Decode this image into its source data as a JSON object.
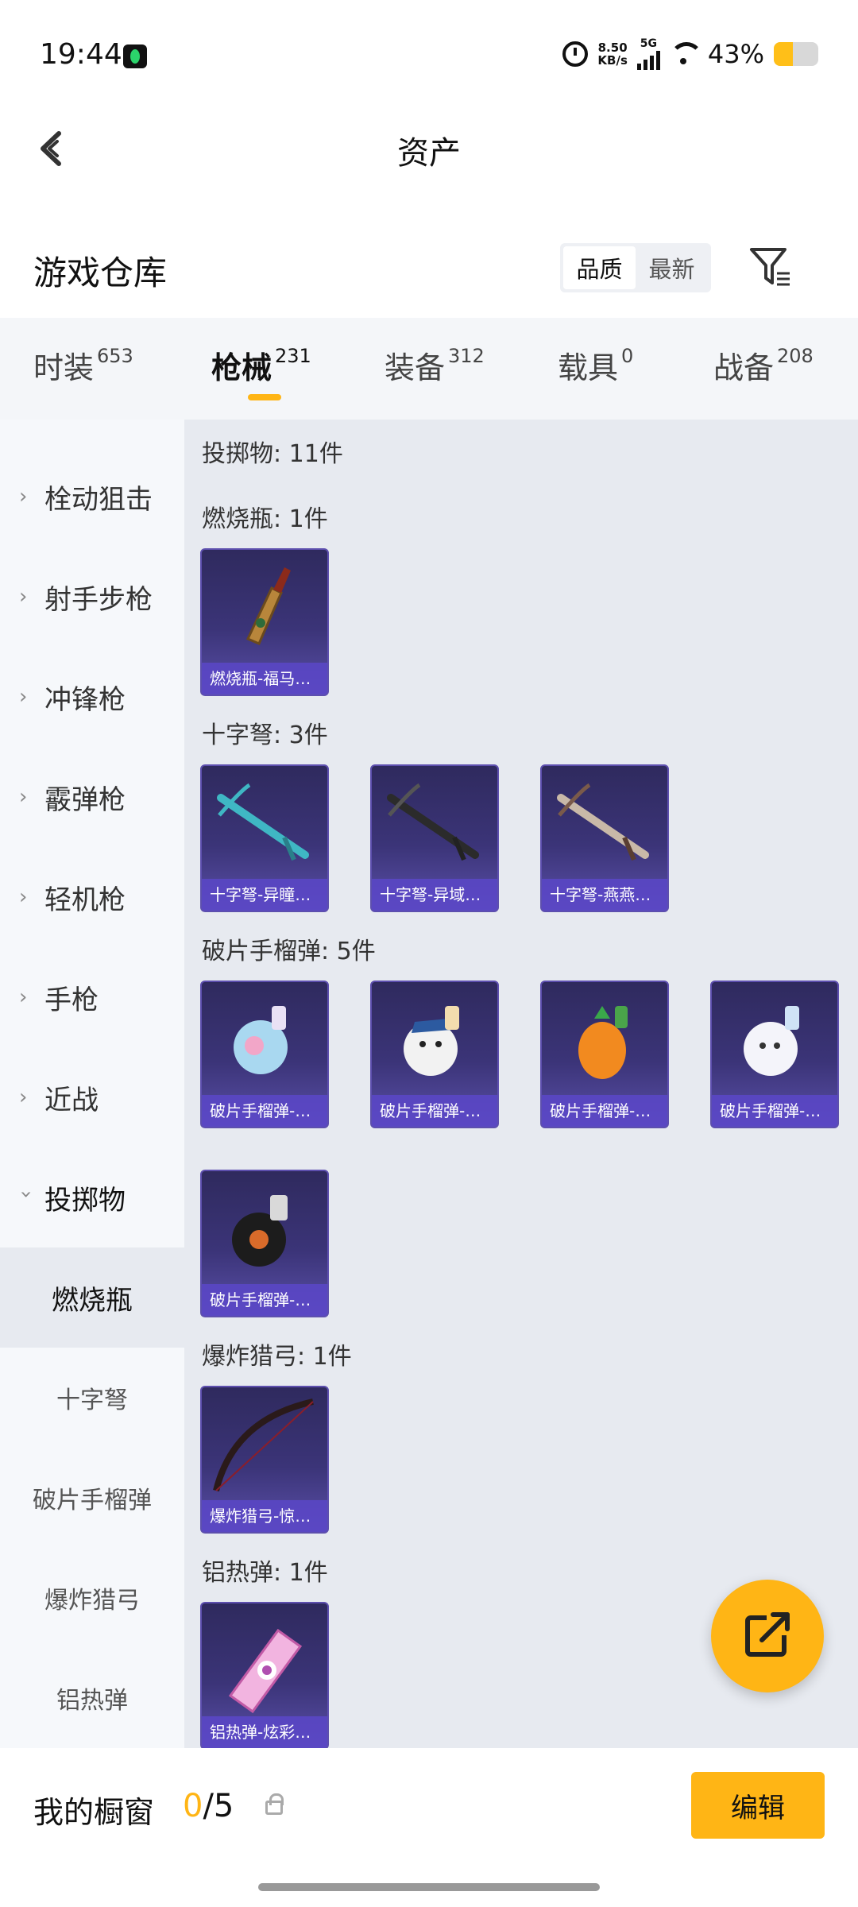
{
  "status_bar": {
    "time": "19:44",
    "net_speed_value": "8.50",
    "net_speed_unit": "KB/s",
    "network": "5G",
    "battery_percent": "43%",
    "battery_level": 0.43
  },
  "header": {
    "title": "资产"
  },
  "section": {
    "title": "游戏仓库",
    "sort_options": [
      "品质",
      "最新"
    ],
    "active_sort": "品质"
  },
  "tabs": [
    {
      "label": "时装",
      "count": "653"
    },
    {
      "label": "枪械",
      "count": "231"
    },
    {
      "label": "装备",
      "count": "312"
    },
    {
      "label": "载具",
      "count": "0"
    },
    {
      "label": "战备",
      "count": "208"
    }
  ],
  "active_tab": "枪械",
  "left_nav": {
    "categories": [
      "栓动狙击",
      "射手步枪",
      "冲锋枪",
      "霰弹枪",
      "轻机枪",
      "手枪",
      "近战",
      "投掷物"
    ],
    "expanded": "投掷物",
    "subcategories": [
      "燃烧瓶",
      "十字弩",
      "破片手榴弹",
      "爆炸猎弓",
      "铝热弹"
    ],
    "active_sub": "燃烧瓶"
  },
  "content": {
    "summary": "投掷物: 11件",
    "groups": [
      {
        "header": "燃烧瓶: 1件",
        "items": [
          "燃烧瓶-福马…"
        ]
      },
      {
        "header": "十字弩: 3件",
        "items": [
          "十字弩-异瞳…",
          "十字弩-异域…",
          "十字弩-燕燕…"
        ]
      },
      {
        "header": "破片手榴弹: 5件",
        "items": [
          "破片手榴弹-…",
          "破片手榴弹-…",
          "破片手榴弹-…",
          "破片手榴弹-…",
          "破片手榴弹-…"
        ]
      },
      {
        "header": "爆炸猎弓: 1件",
        "items": [
          "爆炸猎弓-惊…"
        ]
      },
      {
        "header": "铝热弹: 1件",
        "items": [
          "铝热弹-炫彩…"
        ]
      }
    ]
  },
  "bottom_bar": {
    "showcase_label": "我的橱窗",
    "showcase_used": "0",
    "showcase_total": "/5",
    "edit_label": "编辑"
  },
  "colors": {
    "accent": "#ffb515",
    "card_bg": "#3b3478",
    "content_bg": "#e7eaf0"
  }
}
